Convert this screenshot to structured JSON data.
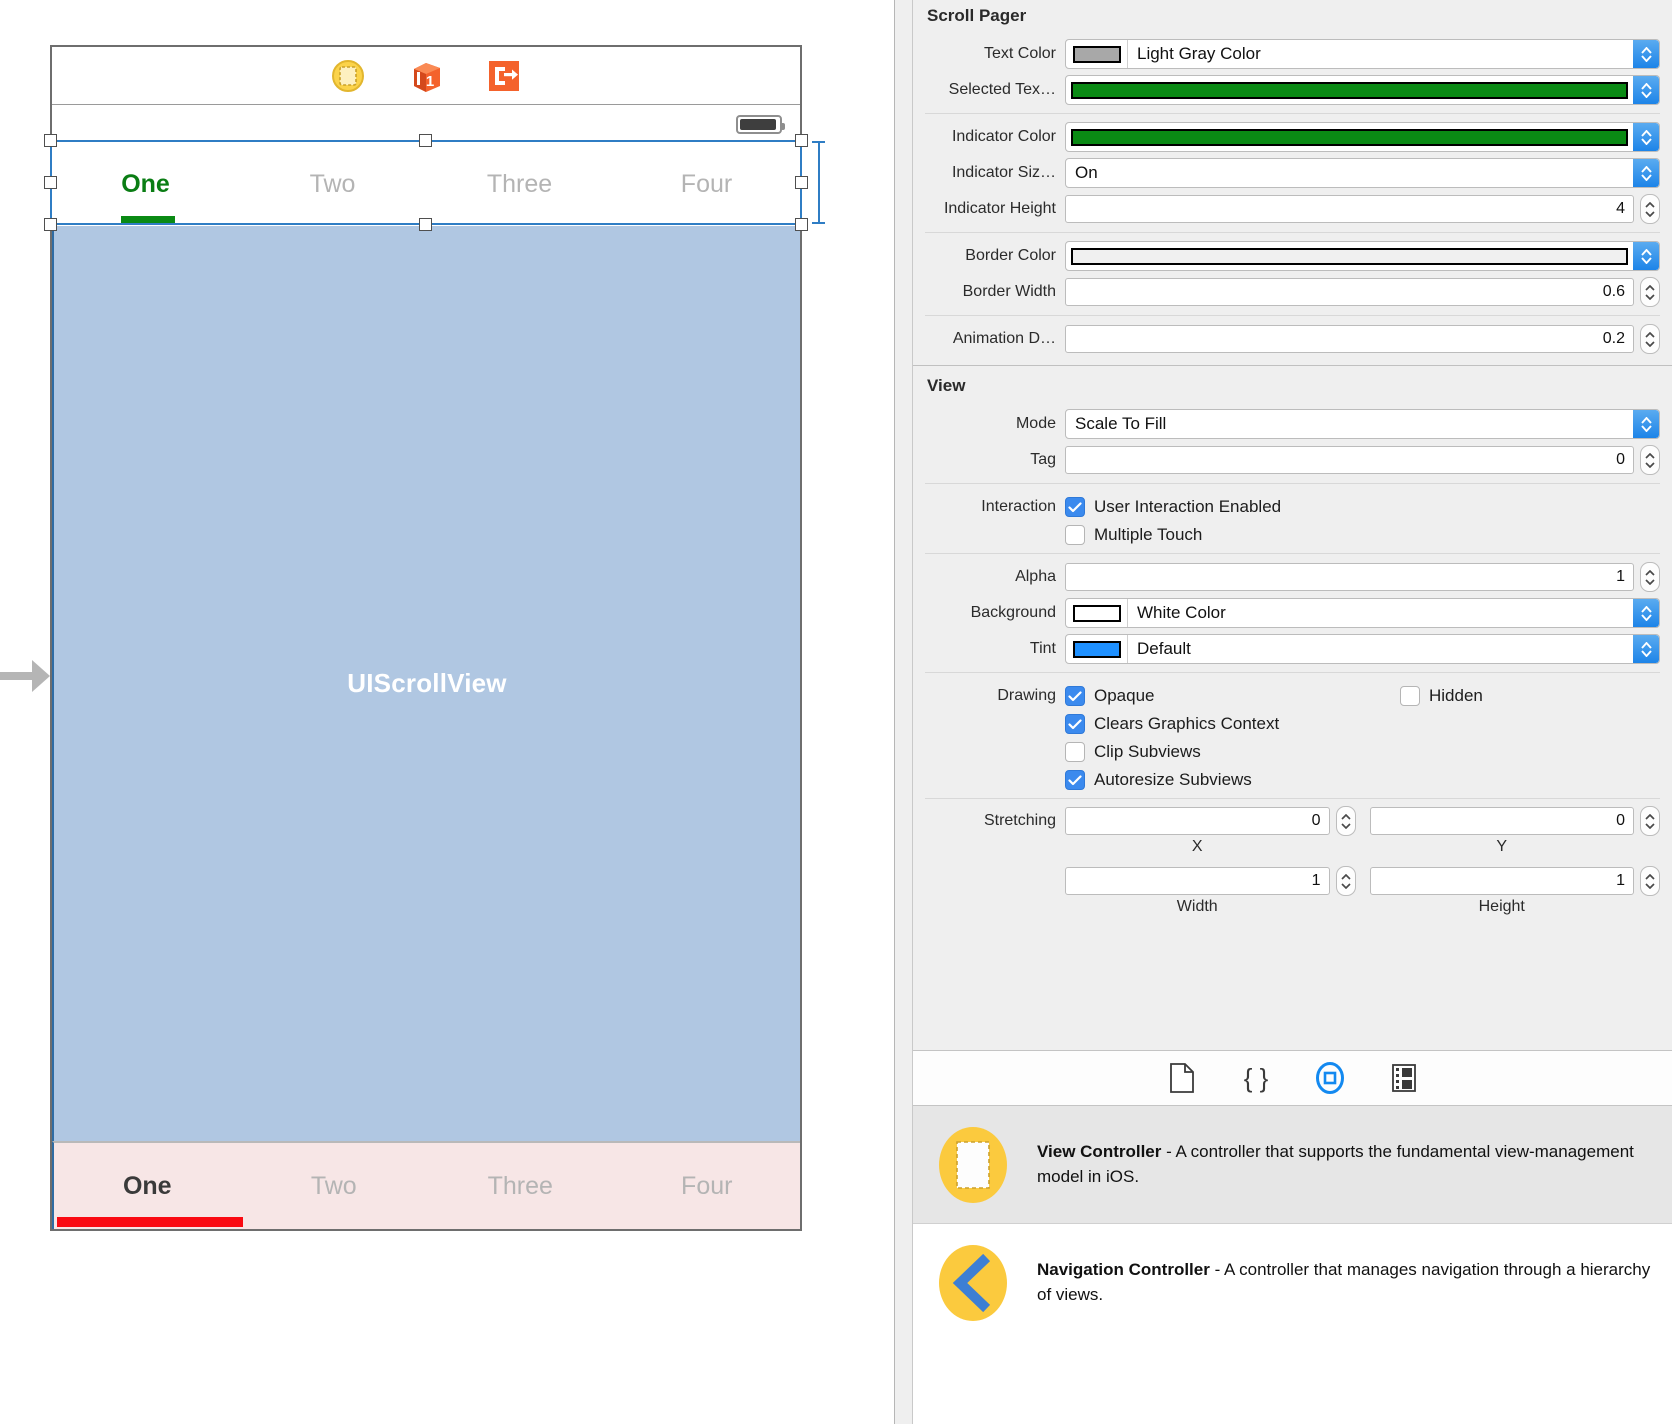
{
  "canvas": {
    "dock_icons": [
      "view-controller-icon",
      "first-responder-icon",
      "exit-segue-icon"
    ],
    "scrollview_label": "UIScrollView",
    "top_pager": {
      "tabs": [
        "One",
        "Two",
        "Three",
        "Four"
      ],
      "selected_index": 0,
      "selected_color": "#0a7d14",
      "unselected_color": "#b4b4b4",
      "indicator_color": "#0a8a14"
    },
    "bottom_pager": {
      "tabs": [
        "One",
        "Two",
        "Three",
        "Four"
      ],
      "selected_index": 0,
      "selected_color": "#3a3a3a",
      "unselected_color": "#b4b4b4",
      "indicator_color": "#fa0a12",
      "background": "#f7e6e6"
    }
  },
  "inspector": {
    "scroll_pager": {
      "title": "Scroll Pager",
      "text_color": {
        "label": "Text Color",
        "value": "Light Gray Color",
        "swatch": "#a8a8a8"
      },
      "selected_text_color": {
        "label": "Selected Tex…",
        "value": "",
        "swatch": "#0a8a14"
      },
      "indicator_color": {
        "label": "Indicator Color",
        "value": "",
        "swatch": "#0a8a14"
      },
      "indicator_size": {
        "label": "Indicator Siz…",
        "value": "On"
      },
      "indicator_height": {
        "label": "Indicator Height",
        "value": "4"
      },
      "border_color": {
        "label": "Border Color",
        "value": "",
        "swatch": "#f0f0f0"
      },
      "border_width": {
        "label": "Border Width",
        "value": "0.6"
      },
      "animation_duration": {
        "label": "Animation D…",
        "value": "0.2"
      }
    },
    "view": {
      "title": "View",
      "mode": {
        "label": "Mode",
        "value": "Scale To Fill"
      },
      "tag": {
        "label": "Tag",
        "value": "0"
      },
      "interaction": {
        "label": "Interaction",
        "items": [
          {
            "label": "User Interaction Enabled",
            "checked": true
          },
          {
            "label": "Multiple Touch",
            "checked": false
          }
        ]
      },
      "alpha": {
        "label": "Alpha",
        "value": "1"
      },
      "background": {
        "label": "Background",
        "value": "White Color",
        "swatch": "#ffffff"
      },
      "tint": {
        "label": "Tint",
        "value": "Default",
        "swatch": "#1e90ff"
      },
      "drawing": {
        "label": "Drawing",
        "left_items": [
          {
            "label": "Opaque",
            "checked": true
          },
          {
            "label": "Clears Graphics Context",
            "checked": true
          },
          {
            "label": "Clip Subviews",
            "checked": false
          },
          {
            "label": "Autoresize Subviews",
            "checked": true
          }
        ],
        "right_items": [
          {
            "label": "Hidden",
            "checked": false
          }
        ]
      },
      "stretching": {
        "label": "Stretching",
        "x": {
          "value": "0",
          "caption": "X"
        },
        "y": {
          "value": "0",
          "caption": "Y"
        },
        "width": {
          "value": "1",
          "caption": "Width"
        },
        "height": {
          "value": "1",
          "caption": "Height"
        }
      }
    },
    "library_tabs": [
      {
        "name": "file-template-library-tab",
        "selected": false
      },
      {
        "name": "code-snippet-library-tab",
        "selected": false
      },
      {
        "name": "object-library-tab",
        "selected": true
      },
      {
        "name": "media-library-tab",
        "selected": false
      }
    ],
    "library_items": [
      {
        "title": "View Controller",
        "description": " - A controller that supports the fundamental view-management model in iOS.",
        "icon": "view-controller-library-icon",
        "selected": true
      },
      {
        "title": "Navigation Controller",
        "description": " - A controller that manages navigation through a hierarchy of views.",
        "icon": "navigation-controller-library-icon",
        "selected": false
      }
    ]
  }
}
